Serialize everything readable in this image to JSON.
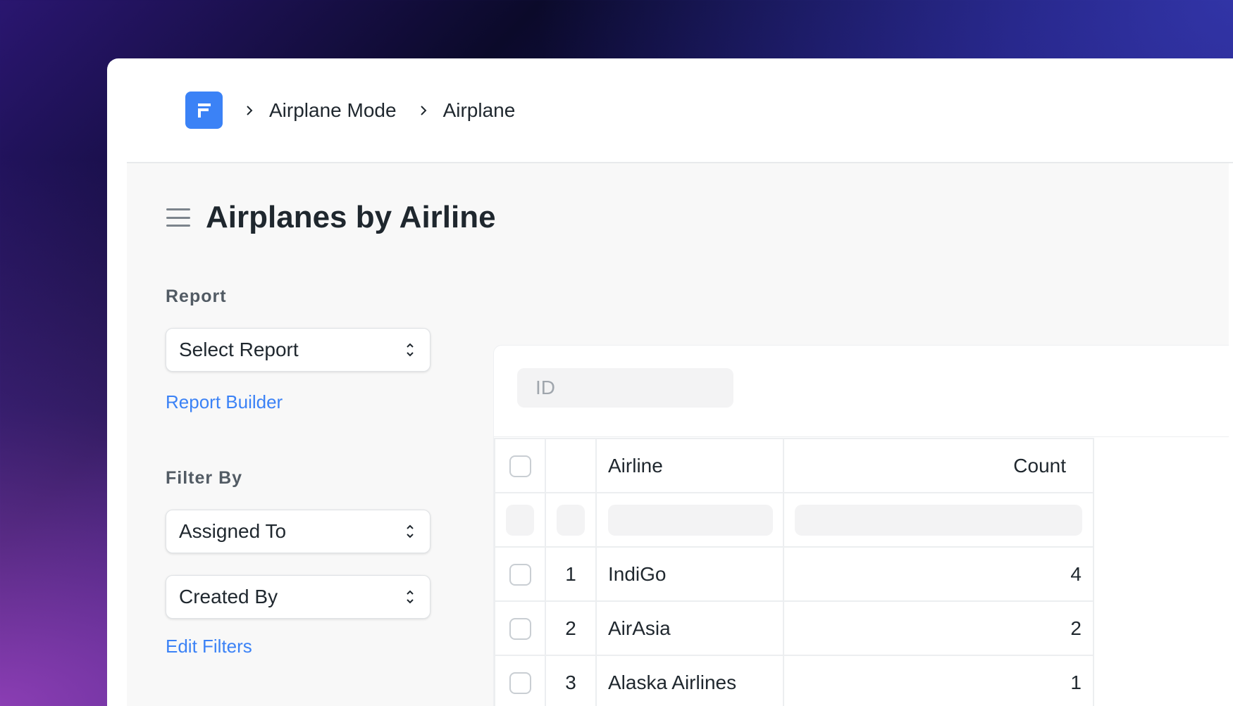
{
  "navbar": {
    "logo_icon": "frappe-logo-icon",
    "breadcrumbs": [
      "Airplane Mode",
      "Airplane"
    ]
  },
  "page": {
    "title": "Airplanes by Airline"
  },
  "sidebar": {
    "report_label": "Report",
    "report_select": "Select Report",
    "report_builder_link": "Report Builder",
    "filter_label": "Filter By",
    "filter_assigned": "Assigned To",
    "filter_created": "Created By",
    "edit_filters_link": "Edit Filters"
  },
  "report": {
    "id_placeholder": "ID",
    "columns": [
      "Airline",
      "Count"
    ],
    "rows": [
      {
        "index": "1",
        "airline": "IndiGo",
        "count": "4"
      },
      {
        "index": "2",
        "airline": "AirAsia",
        "count": "2"
      },
      {
        "index": "3",
        "airline": "Alaska Airlines",
        "count": "1"
      }
    ]
  },
  "colors": {
    "accent": "#3b82f6",
    "text": "#1f272e"
  }
}
